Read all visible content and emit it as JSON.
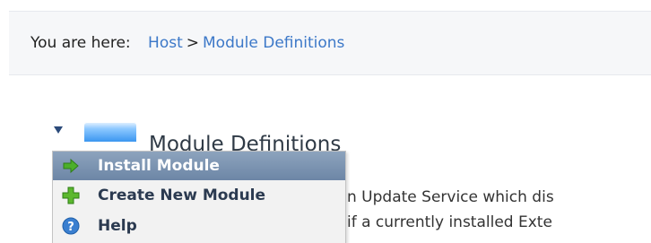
{
  "breadcrumb": {
    "label": "You are here:",
    "items": [
      "Host",
      "Module Definitions"
    ],
    "separator": ">"
  },
  "page_title": "Module Definitions",
  "action_menu": {
    "items": [
      {
        "label": "Install Module",
        "icon": "green-arrow-right-icon",
        "active": true
      },
      {
        "label": "Create New Module",
        "icon": "green-plus-icon",
        "active": false
      },
      {
        "label": "Help",
        "icon": "help-icon",
        "active": false
      }
    ]
  },
  "body_text": {
    "line1": "n Update Service which dis",
    "line2": "if a currently installed Exte"
  },
  "colors": {
    "link": "#3c78c8",
    "menu_active": "#7690b0",
    "title": "#2f3a46"
  }
}
